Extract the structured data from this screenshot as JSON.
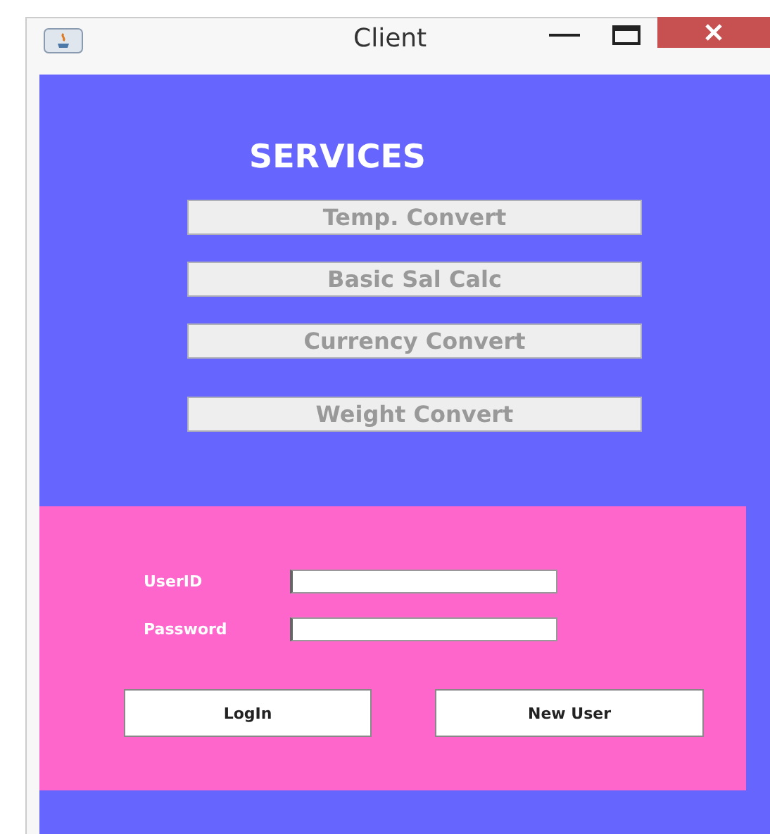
{
  "window": {
    "title": "Client"
  },
  "services": {
    "heading": "SERVICES",
    "buttons": [
      {
        "label": "Temp. Convert",
        "disabled": true
      },
      {
        "label": "Basic Sal Calc",
        "disabled": true
      },
      {
        "label": "Currency Convert",
        "disabled": true
      },
      {
        "label": "Weight Convert",
        "disabled": true
      }
    ]
  },
  "login": {
    "fields": [
      {
        "label": "UserID"
      },
      {
        "label": "Password"
      }
    ],
    "buttons": [
      "LogIn",
      "New User"
    ]
  }
}
